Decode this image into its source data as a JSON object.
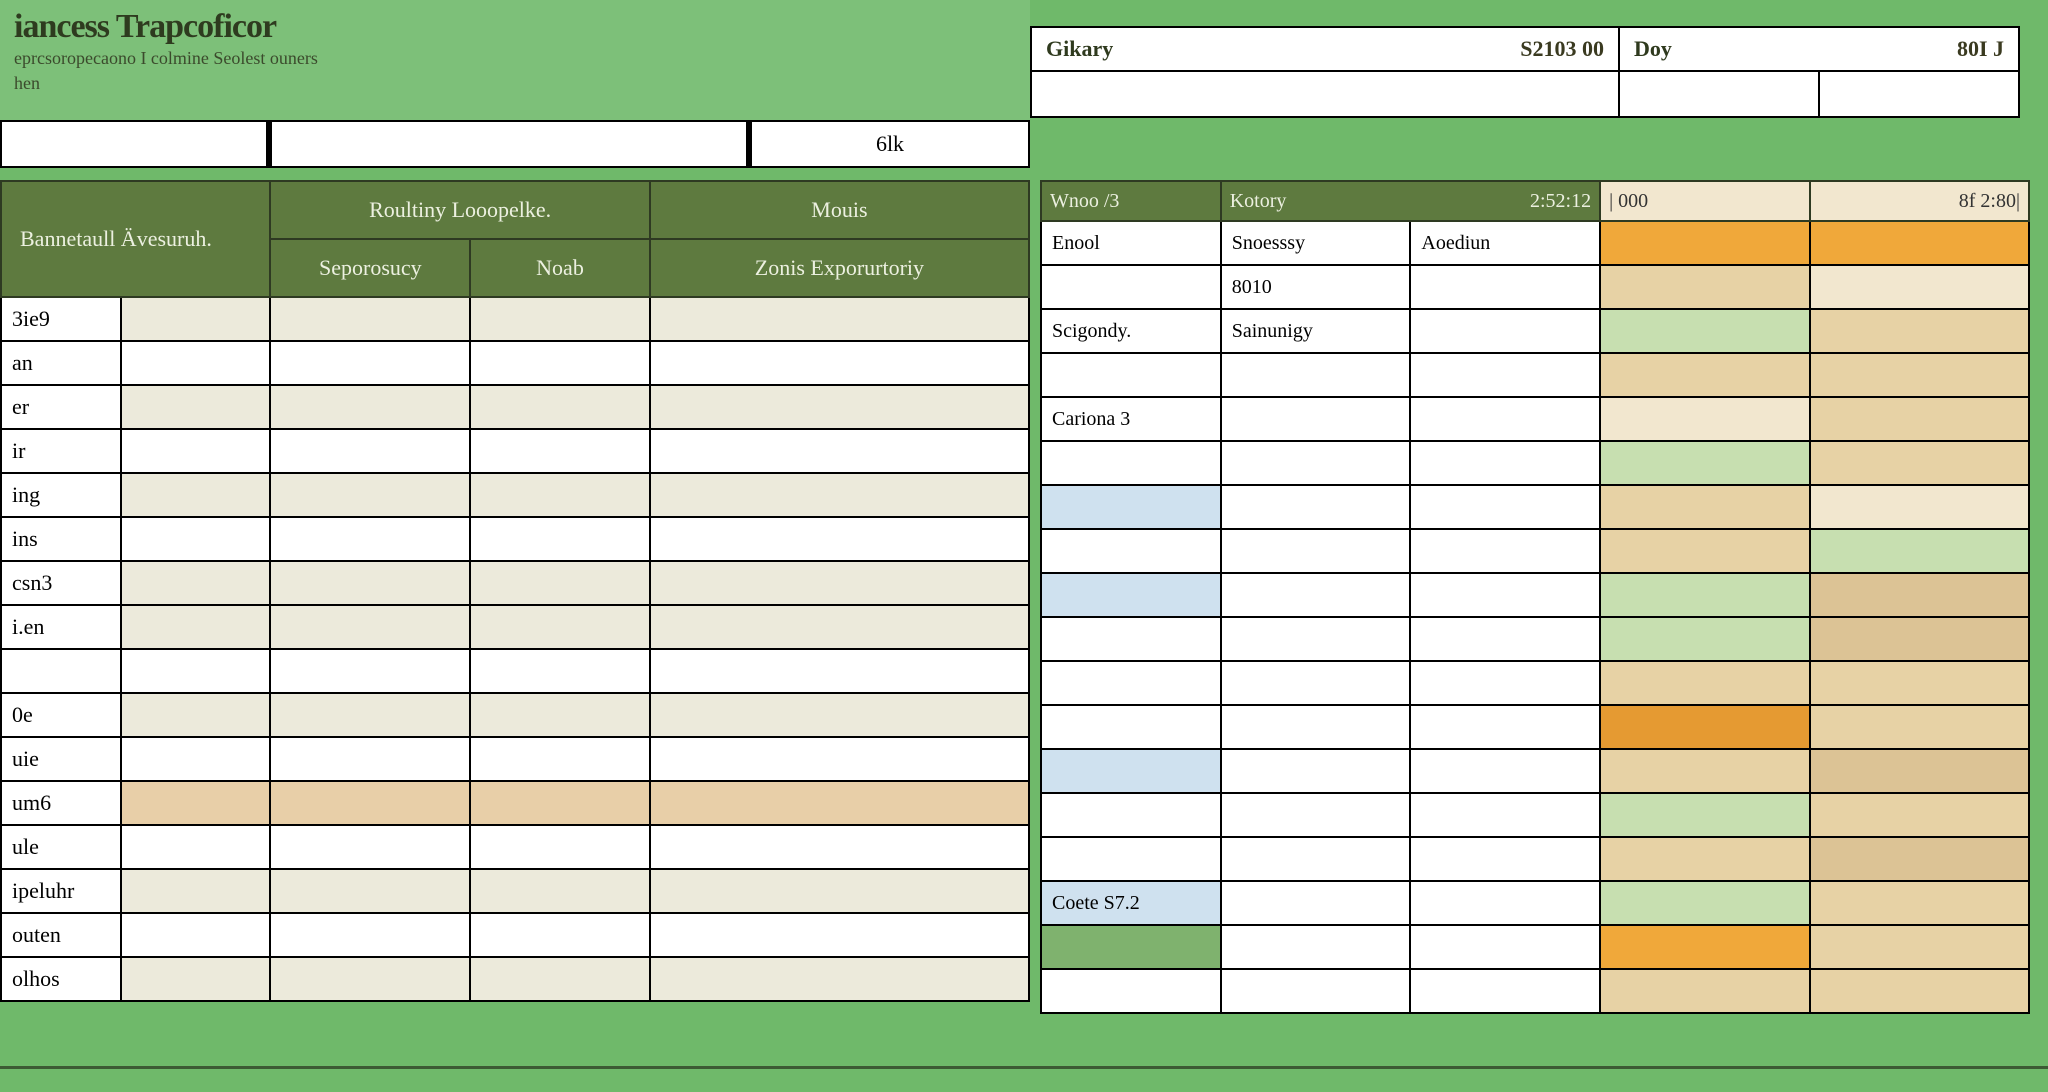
{
  "header": {
    "title": "iancess Trapcoficor",
    "subtitle": "eprcsoropecaono I colmine Seolest ouners",
    "small": "hen",
    "summary": [
      {
        "label": "Gikary",
        "value": "S2103 00"
      },
      {
        "label": "Doy",
        "value": "80I J"
      }
    ]
  },
  "strip": {
    "a": "",
    "b": "",
    "c": "6lk"
  },
  "left": {
    "headers": {
      "h1": "Bannetaull Ävesuruh.",
      "h2a": "Roultiny Looopelke.",
      "h2b": "Seporosucy",
      "h2c": "Noab",
      "h3a": "Mouis",
      "h3b": "Zonis Exporurtoriy"
    },
    "rows": [
      {
        "label": "3ie9",
        "shade": "cream"
      },
      {
        "label": "an",
        "shade": "white"
      },
      {
        "label": "er",
        "shade": "cream"
      },
      {
        "label": "ir",
        "shade": "white"
      },
      {
        "label": "ing",
        "shade": "cream"
      },
      {
        "label": "ins",
        "shade": "white",
        "offset": true
      },
      {
        "label": "csn3",
        "shade": "cream"
      },
      {
        "label": "i.en",
        "shade": "cream"
      },
      {
        "label": "",
        "shade": "white"
      },
      {
        "label": "0e",
        "shade": "cream"
      },
      {
        "label": "uie",
        "shade": "white"
      },
      {
        "label": "um6",
        "shade": "peach"
      },
      {
        "label": "ule",
        "shade": "white"
      },
      {
        "label": "ipeluhr",
        "shade": "cream"
      },
      {
        "label": "outen",
        "shade": "white"
      },
      {
        "label": "olhos",
        "shade": "cream"
      }
    ]
  },
  "right": {
    "headers": {
      "h1": "Wnoo /3",
      "h2": "Kotory",
      "h2v": "2:52:12",
      "h3": "| 000",
      "h4": "8f 2:80|"
    },
    "rows": [
      {
        "c0": "Enool",
        "c1": "Snoesssy",
        "c2": "Aoediun",
        "s3": "orange",
        "s4": "orange"
      },
      {
        "c0": "",
        "c1": "8010",
        "c2": "",
        "s3": "sand",
        "s4": "cream"
      },
      {
        "c0": "Scigondy.",
        "c1": "Sainunigy",
        "c2": "",
        "s3": "lgreen",
        "s4": "sand"
      },
      {
        "c0": "",
        "c1": "",
        "c2": "",
        "s3": "sand",
        "s4": "sand"
      },
      {
        "c0": "Cariona 3",
        "c1": "",
        "c2": "",
        "s3": "cream",
        "s4": "sand"
      },
      {
        "c0": "",
        "c1": "",
        "c2": "",
        "s3": "lgreen",
        "s4": "sand"
      },
      {
        "c0": "",
        "c1": "",
        "c2": "",
        "s0": "blue",
        "s3": "sand",
        "s4": "cream"
      },
      {
        "c0": "",
        "c1": "",
        "c2": "",
        "s3": "sand",
        "s4": "lgreen"
      },
      {
        "c0": "",
        "c1": "",
        "c2": "",
        "s0": "blue",
        "s3": "lgreen",
        "s4": "tan"
      },
      {
        "c0": "",
        "c1": "",
        "c2": "",
        "s3": "lgreen",
        "s4": "tan"
      },
      {
        "c0": "",
        "c1": "",
        "c2": "",
        "s3": "sand",
        "s4": "sand"
      },
      {
        "c0": "",
        "c1": "",
        "c2": "",
        "s3": "dorange",
        "s4": "sand"
      },
      {
        "c0": "",
        "c1": "",
        "c2": "",
        "s0": "blue",
        "s3": "sand",
        "s4": "tan"
      },
      {
        "c0": "",
        "c1": "",
        "c2": "",
        "s3": "lgreen",
        "s4": "sand"
      },
      {
        "c0": "",
        "c1": "",
        "c2": "",
        "s3": "sand",
        "s4": "tan"
      },
      {
        "c0": "Coete S7.2",
        "c1": "",
        "c2": "",
        "s0": "blue",
        "s3": "lgreen",
        "s4": "sand"
      },
      {
        "c0": "",
        "c1": "",
        "c2": "",
        "s0": "green",
        "s3": "orange",
        "s4": "sand"
      },
      {
        "c0": "",
        "c1": "",
        "c2": "",
        "s3": "sand",
        "s4": "sand"
      }
    ]
  }
}
